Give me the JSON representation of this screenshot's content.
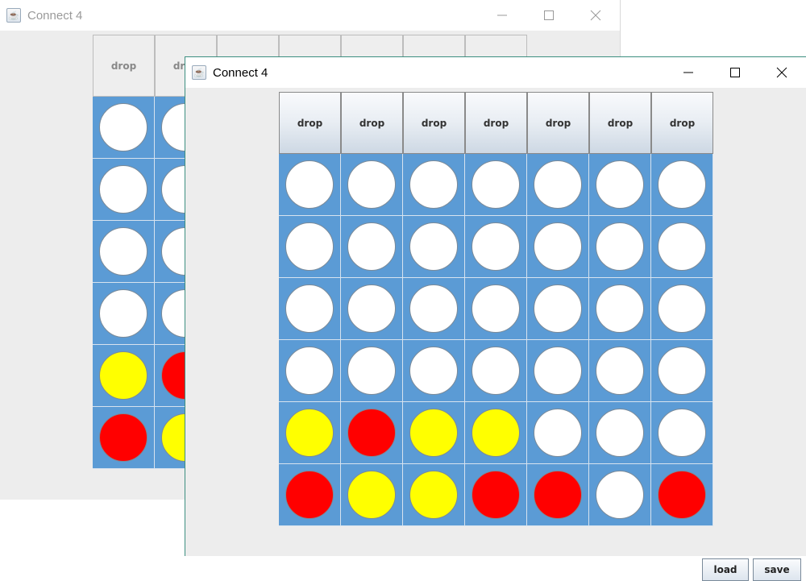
{
  "back_window": {
    "title": "Connect 4",
    "drop_label": "drop",
    "visible_columns": 2,
    "board": [
      [
        "empty",
        "empty"
      ],
      [
        "empty",
        "empty"
      ],
      [
        "empty",
        "empty"
      ],
      [
        "empty",
        "empty"
      ],
      [
        "yellow",
        "red"
      ],
      [
        "red",
        "yellow"
      ]
    ]
  },
  "front_window": {
    "title": "Connect 4",
    "drop_buttons": [
      "drop",
      "drop",
      "drop",
      "drop",
      "drop",
      "drop",
      "drop"
    ],
    "board": [
      [
        "empty",
        "empty",
        "empty",
        "empty",
        "empty",
        "empty",
        "empty"
      ],
      [
        "empty",
        "empty",
        "empty",
        "empty",
        "empty",
        "empty",
        "empty"
      ],
      [
        "empty",
        "empty",
        "empty",
        "empty",
        "empty",
        "empty",
        "empty"
      ],
      [
        "empty",
        "empty",
        "empty",
        "empty",
        "empty",
        "empty",
        "empty"
      ],
      [
        "yellow",
        "red",
        "yellow",
        "yellow",
        "empty",
        "empty",
        "empty"
      ],
      [
        "red",
        "yellow",
        "yellow",
        "red",
        "red",
        "empty",
        "red"
      ]
    ],
    "load_label": "load",
    "save_label": "save"
  },
  "colors": {
    "board_blue": "#5b9bd5",
    "disc_yellow": "#ffff00",
    "disc_red": "#ff0000",
    "disc_empty": "#ffffff"
  },
  "icons": {
    "app": "java-coffee-icon",
    "minimize": "minimize-icon",
    "maximize": "maximize-icon",
    "close": "close-icon"
  }
}
